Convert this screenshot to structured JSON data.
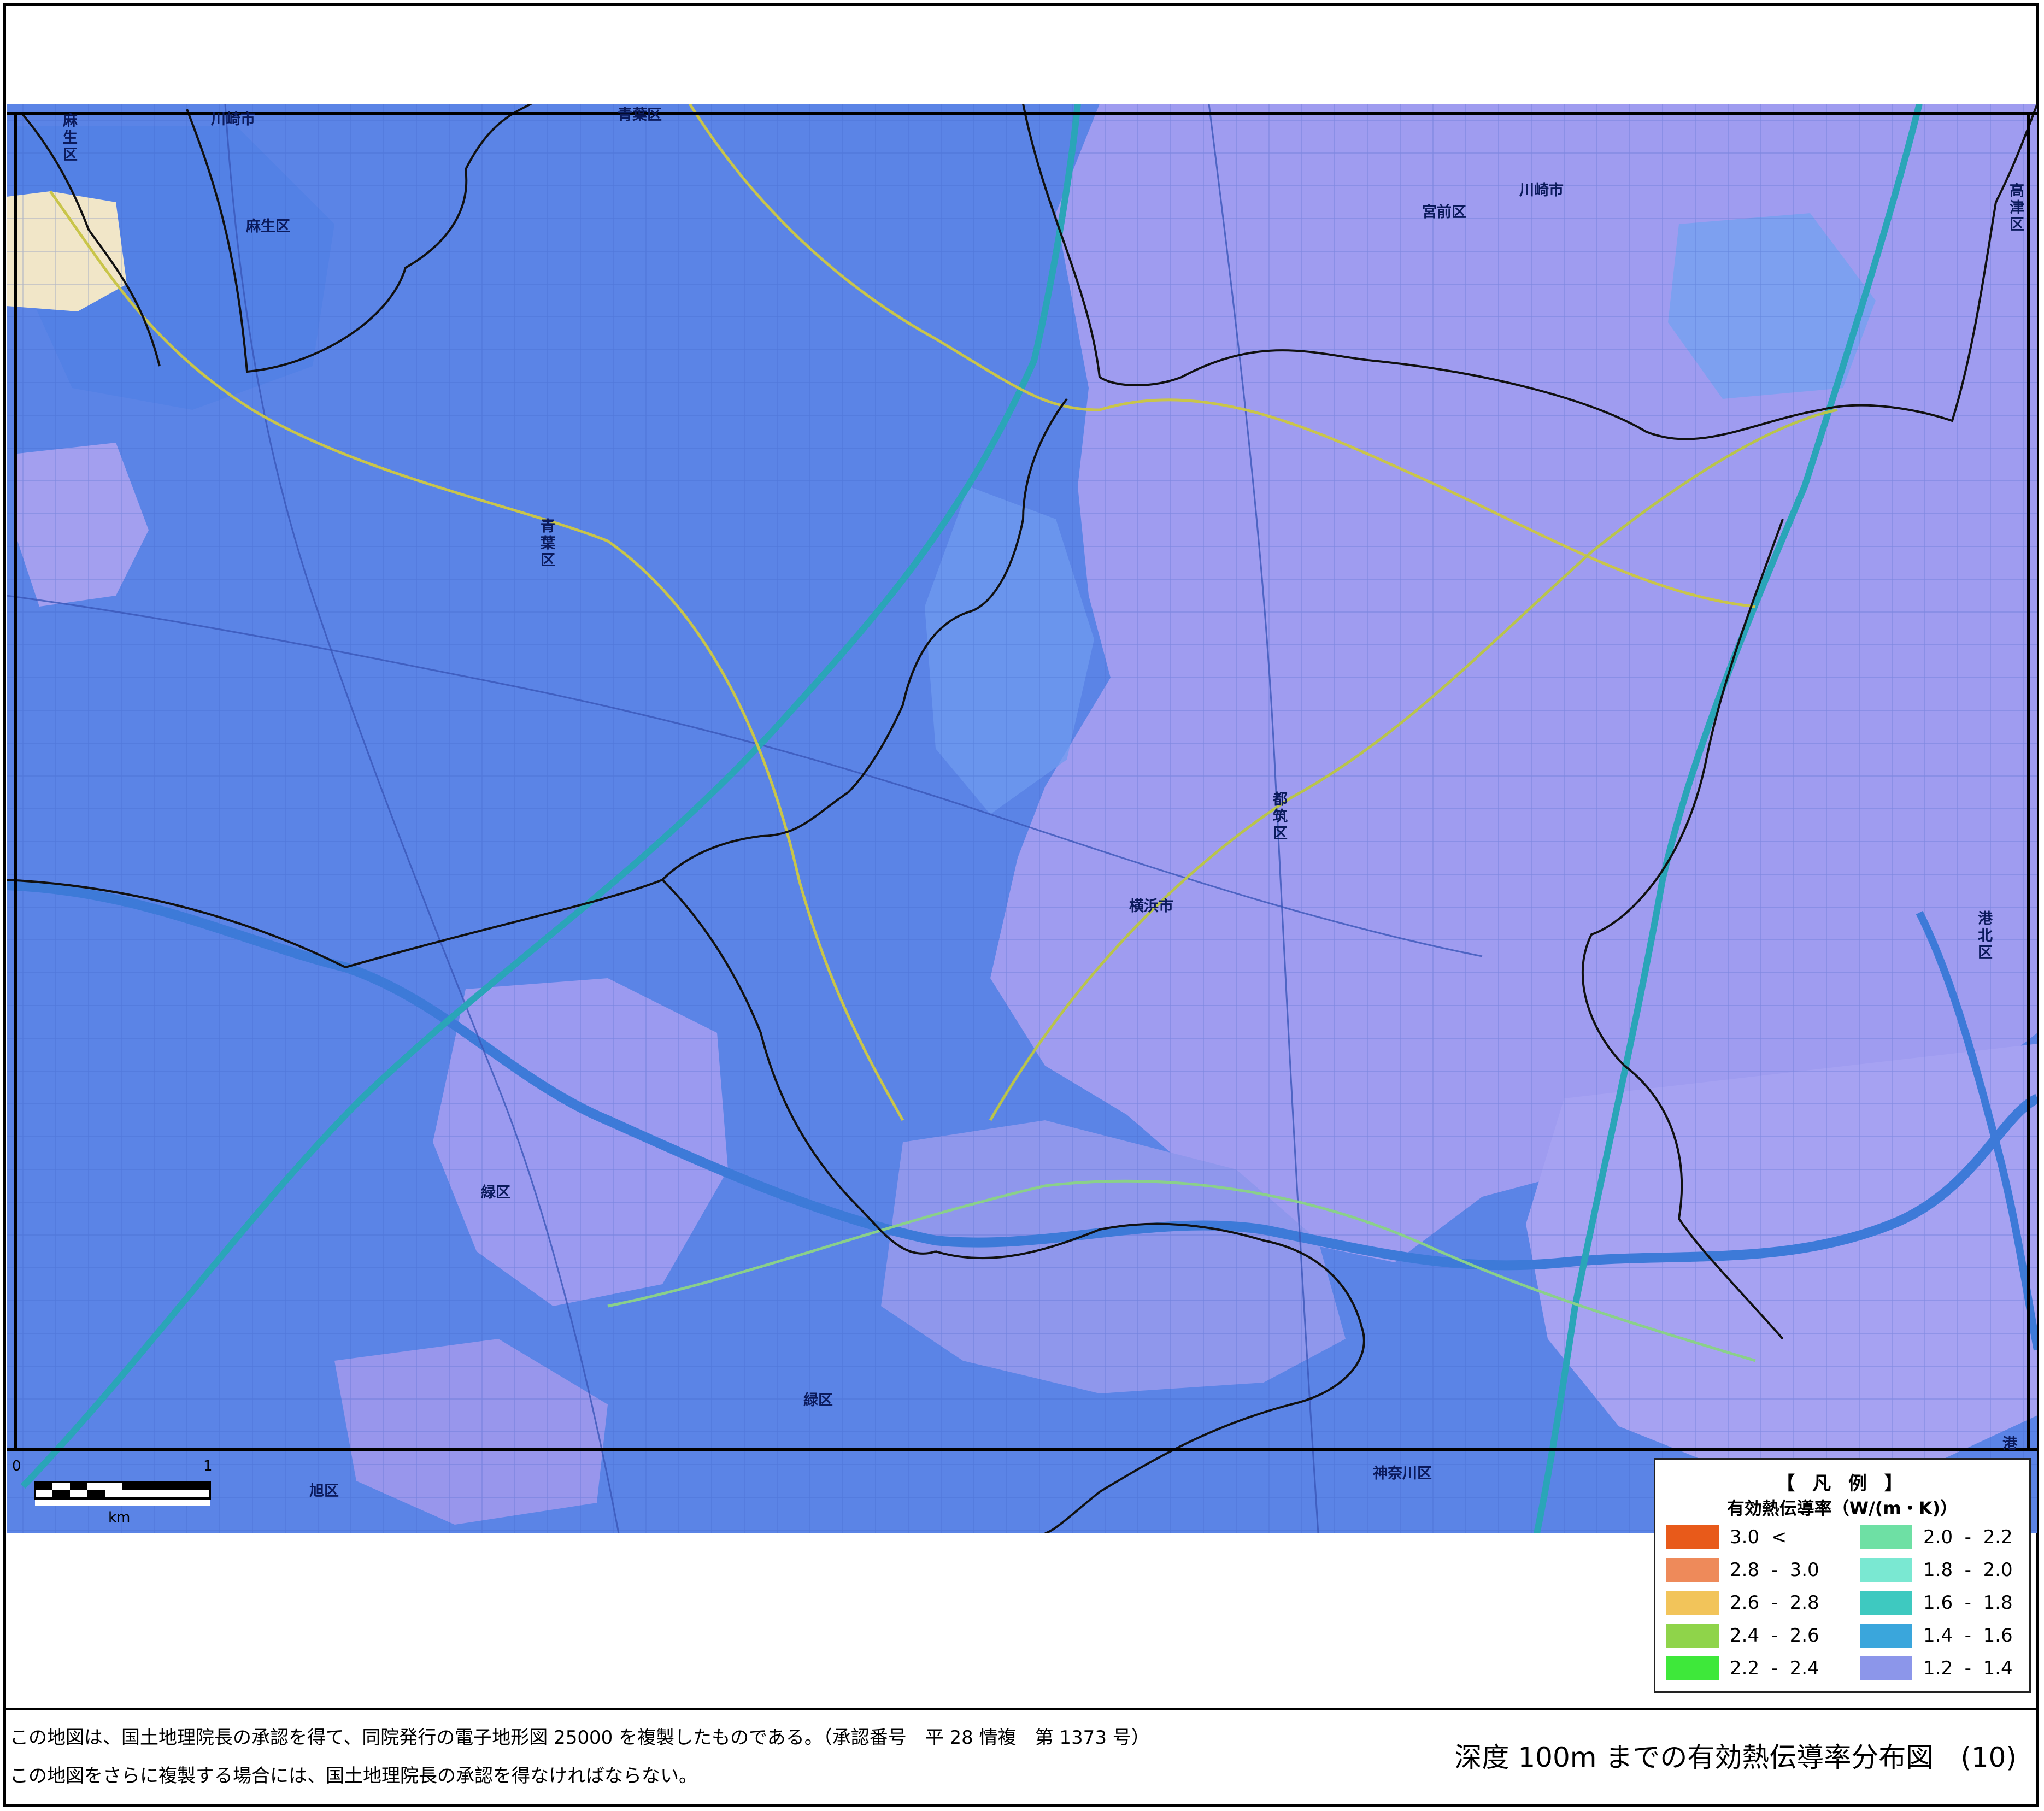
{
  "map": {
    "colors": {
      "base": "#5b84e6",
      "violet_zone": "#9f9cf0",
      "light_zone": "#6fa3ef",
      "border": "#111111",
      "expressway": "#2aa5b8",
      "rail": "#c9c54a",
      "river": "#3d7ad8",
      "road": "#3a56b8",
      "cream": "#f1e6c8"
    },
    "districts": [
      {
        "id": "asao-nw",
        "label": "麻生区",
        "vertical": true
      },
      {
        "id": "asao",
        "label": "麻生区",
        "vertical": false
      },
      {
        "id": "kawasaki-nw",
        "label": "川崎市",
        "vertical": false
      },
      {
        "id": "aoba-top",
        "label": "青葉区",
        "vertical": false
      },
      {
        "id": "miyamae",
        "label": "宮前区",
        "vertical": false
      },
      {
        "id": "kawasaki",
        "label": "川崎市",
        "vertical": false
      },
      {
        "id": "takatsu",
        "label": "高津区",
        "vertical": true
      },
      {
        "id": "aoba",
        "label": "青葉区",
        "vertical": true
      },
      {
        "id": "tsuzuki",
        "label": "都筑区",
        "vertical": true
      },
      {
        "id": "yokohama",
        "label": "横浜市",
        "vertical": false
      },
      {
        "id": "kohoku",
        "label": "港北区",
        "vertical": true
      },
      {
        "id": "midori-w",
        "label": "緑区",
        "vertical": false
      },
      {
        "id": "midori",
        "label": "緑区",
        "vertical": false
      },
      {
        "id": "asahi",
        "label": "旭区",
        "vertical": false
      },
      {
        "id": "kanagawa",
        "label": "神奈川区",
        "vertical": false
      },
      {
        "id": "kohoku-se",
        "label": "港",
        "vertical": false
      }
    ]
  },
  "scale": {
    "zero": "0",
    "one": "1",
    "unit": "km"
  },
  "legend": {
    "title": "【 凡 例 】",
    "subtitle": "有効熱伝導率（W/(m・K)）",
    "items": [
      {
        "label": "3.0  <",
        "color": "#e85a1a"
      },
      {
        "label": "2.8  -  3.0",
        "color": "#ee8a5a"
      },
      {
        "label": "2.6  -  2.8",
        "color": "#f2c45a"
      },
      {
        "label": "2.4  -  2.6",
        "color": "#8fd44a"
      },
      {
        "label": "2.2  -  2.4",
        "color": "#3ee83a"
      },
      {
        "label": "2.0  -  2.2",
        "color": "#6ee0a4"
      },
      {
        "label": "1.8  -  2.0",
        "color": "#7ae8d2"
      },
      {
        "label": "1.6  -  1.8",
        "color": "#3ec9c0"
      },
      {
        "label": "1.4  -  1.6",
        "color": "#3aa6dc"
      },
      {
        "label": "1.2  -  1.4",
        "color": "#8c96ea"
      }
    ]
  },
  "footer": {
    "approval_line_1": "この地図は、国土地理院長の承認を得て、同院発行の電子地形図 25000 を複製したものである。（承認番号　平 28 情複　第 1373 号）",
    "approval_line_2": "この地図をさらに複製する場合には、国土地理院長の承認を得なければならない。",
    "title": "深度 100m までの有効熱伝導率分布図　(10)"
  }
}
